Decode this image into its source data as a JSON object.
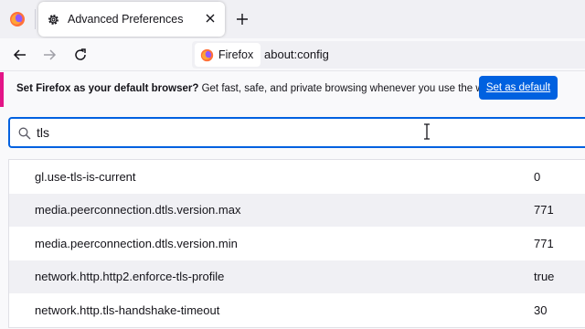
{
  "tabs": {
    "firefox_view_icon": "firefox-icon",
    "active": {
      "title": "Advanced Preferences",
      "icon": "gear-icon"
    },
    "new_tab_icon": "plus-icon"
  },
  "navbar": {
    "identity_label": "Firefox",
    "url": "about:config"
  },
  "banner": {
    "bold": "Set Firefox as your default browser?",
    "text": " Get fast, safe, and private browsing whenever you use the web.",
    "button": "Set as default",
    "accent": "#e31587"
  },
  "search": {
    "value": "tls"
  },
  "prefs": [
    {
      "name": "gl.use-tls-is-current",
      "value": "0"
    },
    {
      "name": "media.peerconnection.dtls.version.max",
      "value": "771"
    },
    {
      "name": "media.peerconnection.dtls.version.min",
      "value": "771"
    },
    {
      "name": "network.http.http2.enforce-tls-profile",
      "value": "true"
    },
    {
      "name": "network.http.tls-handshake-timeout",
      "value": "30"
    }
  ],
  "colors": {
    "accent": "#0061e0"
  }
}
